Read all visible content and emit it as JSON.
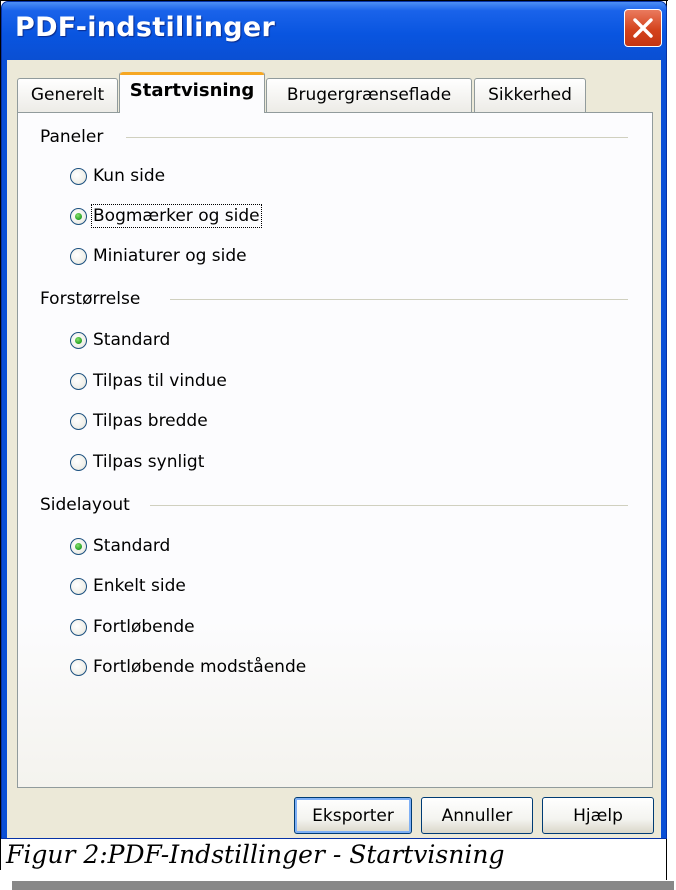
{
  "window": {
    "title": "PDF-indstillinger"
  },
  "tabs": [
    {
      "label": "Generelt",
      "active": false
    },
    {
      "label": "Startvisning",
      "active": true
    },
    {
      "label": "Brugergrænseflade",
      "active": false
    },
    {
      "label": "Sikkerhed",
      "active": false
    }
  ],
  "groups": {
    "paneler": {
      "label": "Paneler",
      "options": [
        {
          "label": "Kun side",
          "checked": false
        },
        {
          "label": "Bogmærker og side",
          "checked": true
        },
        {
          "label": "Miniaturer og side",
          "checked": false
        }
      ]
    },
    "forstorrelse": {
      "label": "Forstørrelse",
      "options": [
        {
          "label": "Standard",
          "checked": true
        },
        {
          "label": "Tilpas til vindue",
          "checked": false
        },
        {
          "label": "Tilpas bredde",
          "checked": false
        },
        {
          "label": "Tilpas synligt",
          "checked": false
        }
      ]
    },
    "sidelayout": {
      "label": "Sidelayout",
      "options": [
        {
          "label": "Standard",
          "checked": true
        },
        {
          "label": "Enkelt side",
          "checked": false
        },
        {
          "label": "Fortløbende",
          "checked": false
        },
        {
          "label": "Fortløbende modstående",
          "checked": false
        }
      ]
    }
  },
  "buttons": {
    "export": "Eksporter",
    "cancel": "Annuller",
    "help": "Hjælp"
  },
  "caption": "Figur 2:PDF-Indstillinger - Startvisning",
  "colors": {
    "titlebar": "#0a4fd6",
    "dialog_face": "#ece9d8",
    "active_tab_accent": "#f6a723",
    "close_button": "#d4431d",
    "radio_dot": "#21a121"
  },
  "icons": {
    "close": "close-x-icon"
  }
}
